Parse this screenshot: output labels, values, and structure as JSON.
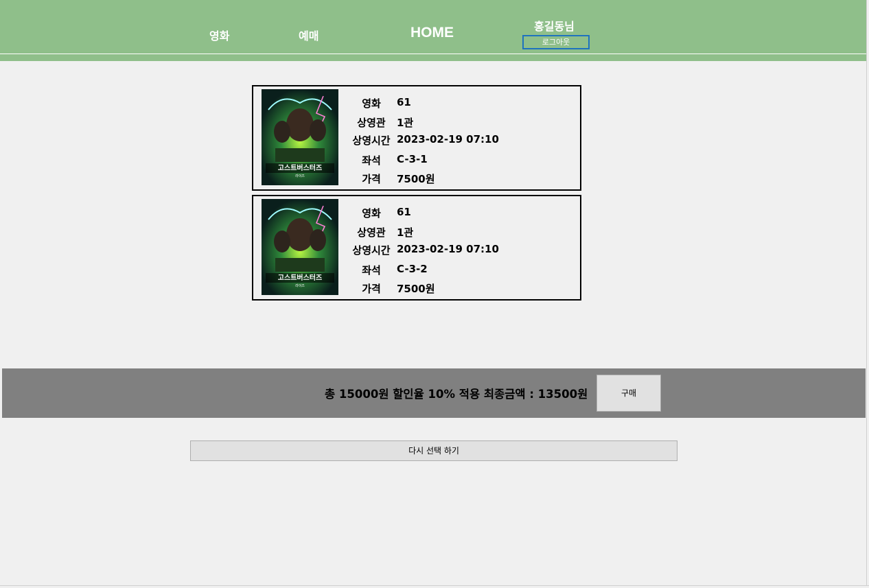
{
  "header": {
    "nav_movie": "영화",
    "nav_reserve": "예매",
    "nav_home": "HOME",
    "user_name": "홍길동님",
    "logout_label": "로그아웃"
  },
  "labels": {
    "movie": "영화",
    "hall": "상영관",
    "showtime": "상영시간",
    "seat": "좌석",
    "price": "가격"
  },
  "tickets": [
    {
      "poster_title": "고스트버스터즈",
      "poster_subtitle": "라이즈",
      "movie": "61",
      "hall": "1관",
      "showtime": "2023-02-19 07:10",
      "seat": "C-3-1",
      "price": "7500원"
    },
    {
      "poster_title": "고스트버스터즈",
      "poster_subtitle": "라이즈",
      "movie": "61",
      "hall": "1관",
      "showtime": "2023-02-19 07:10",
      "seat": "C-3-2",
      "price": "7500원"
    }
  ],
  "purchase": {
    "summary": "총 15000원 할인율 10% 적용 최종금액 : 13500원",
    "buy_label": "구매"
  },
  "reselect_label": "다시 선택 하기",
  "colors": {
    "header_bg": "#8fbf8a",
    "purchase_bar_bg": "#808080",
    "logout_border": "#1e73be"
  }
}
